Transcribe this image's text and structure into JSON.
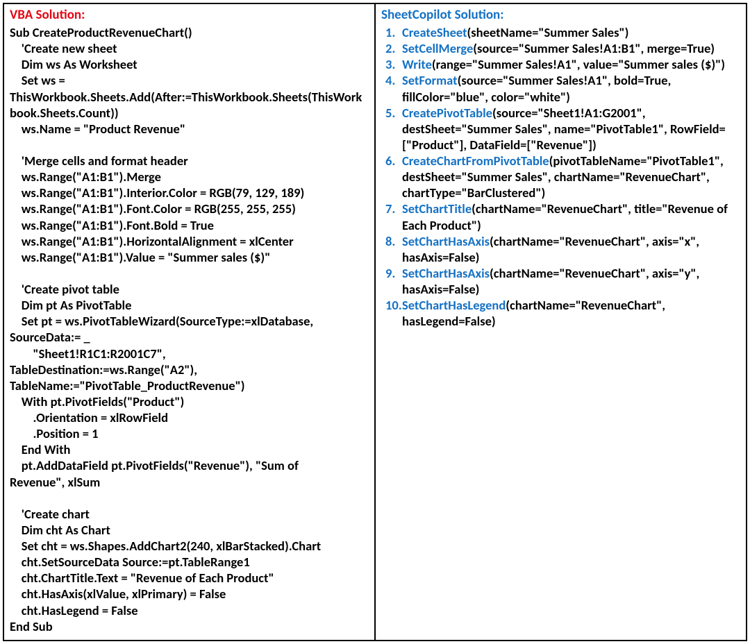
{
  "left": {
    "title": "VBA Solution:",
    "code": "Sub CreateProductRevenueChart()\n    'Create new sheet\n    Dim ws As Worksheet\n    Set ws =\nThisWorkbook.Sheets.Add(After:=ThisWorkbook.Sheets(ThisWorkbook.Sheets.Count))\n    ws.Name = \"Product Revenue\"\n\n    'Merge cells and format header\n    ws.Range(\"A1:B1\").Merge\n    ws.Range(\"A1:B1\").Interior.Color = RGB(79, 129, 189)\n    ws.Range(\"A1:B1\").Font.Color = RGB(255, 255, 255)\n    ws.Range(\"A1:B1\").Font.Bold = True\n    ws.Range(\"A1:B1\").HorizontalAlignment = xlCenter\n    ws.Range(\"A1:B1\").Value = \"Summer sales ($)\"\n\n    'Create pivot table\n    Dim pt As PivotTable\n    Set pt = ws.PivotTableWizard(SourceType:=xlDatabase,\nSourceData:= _\n        \"Sheet1!R1C1:R2001C7\",\nTableDestination:=ws.Range(\"A2\"),\nTableName:=\"PivotTable_ProductRevenue\")\n    With pt.PivotFields(\"Product\")\n        .Orientation = xlRowField\n        .Position = 1\n    End With\n    pt.AddDataField pt.PivotFields(\"Revenue\"), \"Sum of\nRevenue\", xlSum\n\n    'Create chart\n    Dim cht As Chart\n    Set cht = ws.Shapes.AddChart2(240, xlBarStacked).Chart\n    cht.SetSourceData Source:=pt.TableRange1\n    cht.ChartTitle.Text = \"Revenue of Each Product\"\n    cht.HasAxis(xlValue, xlPrimary) = False\n    cht.HasLegend = False\nEnd Sub"
  },
  "right": {
    "title": "SheetCopilot Solution:",
    "steps": [
      {
        "n": "1.",
        "fn": "CreateSheet",
        "args": "(sheetName=\"Summer Sales\")"
      },
      {
        "n": "2.",
        "fn": "SetCellMerge",
        "args": "(source=\"Summer Sales!A1:B1\", merge=True)"
      },
      {
        "n": "3.",
        "fn": "Write",
        "args": "(range=\"Summer Sales!A1\", value=\"Summer sales ($)\")"
      },
      {
        "n": "4.",
        "fn": "SetFormat",
        "args": "(source=\"Summer Sales!A1\", bold=True, fillColor=\"blue\", color=\"white\")"
      },
      {
        "n": "5.",
        "fn": "CreatePivotTable",
        "args": "(source=\"Sheet1!A1:G2001\", destSheet=\"Summer Sales\", name=\"PivotTable1\", RowField=[\"Product\"], DataField=[\"Revenue\"])"
      },
      {
        "n": "6.",
        "fn": "CreateChartFromPivotTable",
        "args": "(pivotTableName=\"PivotTable1\", destSheet=\"Summer Sales\", chartName=\"RevenueChart\", chartType=\"BarClustered\")"
      },
      {
        "n": "7.",
        "fn": "SetChartTitle",
        "args": "(chartName=\"RevenueChart\", title=\"Revenue of Each Product\")"
      },
      {
        "n": "8.",
        "fn": "SetChartHasAxis",
        "args": "(chartName=\"RevenueChart\", axis=\"x\", hasAxis=False)"
      },
      {
        "n": "9.",
        "fn": "SetChartHasAxis",
        "args": "(chartName=\"RevenueChart\", axis=\"y\", hasAxis=False)"
      },
      {
        "n": "10.",
        "fn": "SetChartHasLegend",
        "args": "(chartName=\"RevenueChart\", hasLegend=False)"
      }
    ]
  }
}
